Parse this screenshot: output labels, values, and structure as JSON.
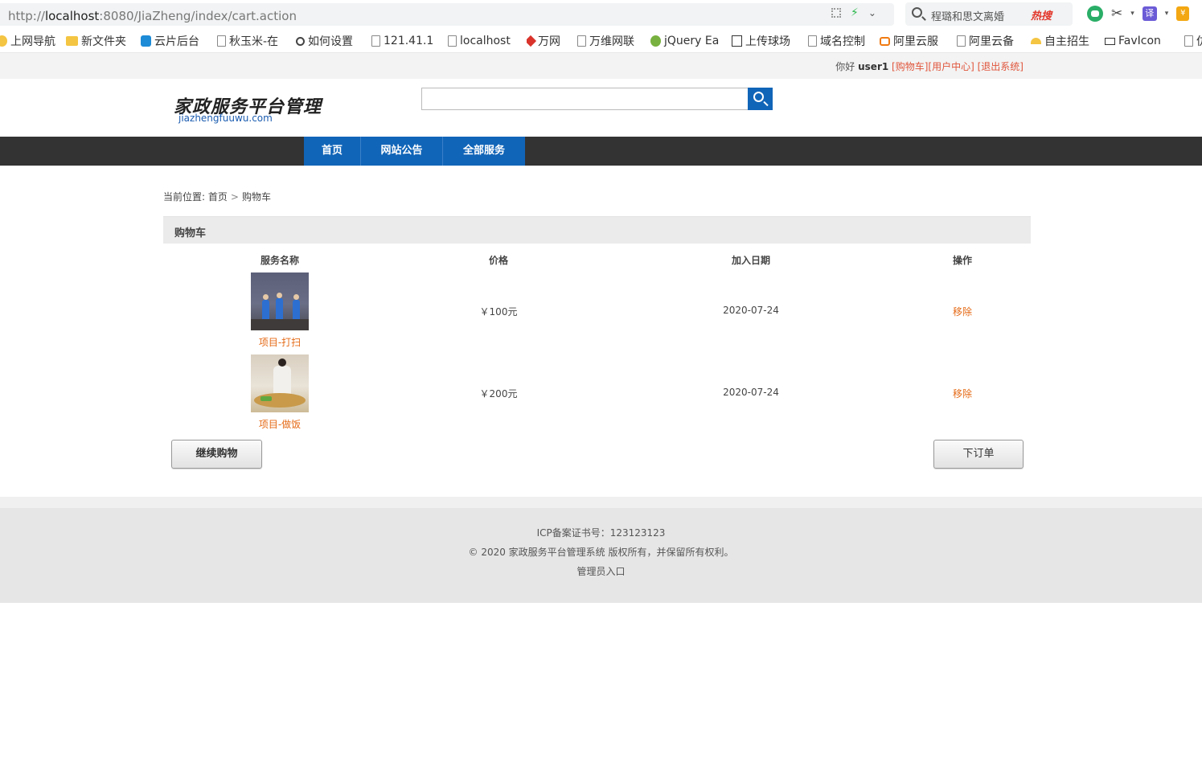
{
  "browser": {
    "url_prefix": "http://",
    "url_host": "localhost",
    "url_rest": ":8080/JiaZheng/index/cart.action",
    "search_text": "程璐和思文离婚",
    "hot_label": "热搜",
    "translate_label": "译",
    "yen_label": "¥",
    "bookmarks": [
      {
        "label": "上网导航",
        "icon": "smile-icon"
      },
      {
        "label": "新文件夹",
        "icon": "folder-icon"
      },
      {
        "label": "云片后台",
        "icon": "cloud-icon"
      },
      {
        "label": "秋玉米-在",
        "icon": "page-icon"
      },
      {
        "label": "如何设置",
        "icon": "swirl-icon"
      },
      {
        "label": "121.41.1",
        "icon": "page-icon"
      },
      {
        "label": "localhost",
        "icon": "page-icon"
      },
      {
        "label": "万网",
        "icon": "wanwang-icon"
      },
      {
        "label": "万维网联",
        "icon": "page-icon"
      },
      {
        "label": "jQuery Ea",
        "icon": "jquery-icon"
      },
      {
        "label": "上传球场",
        "icon": "image-icon"
      },
      {
        "label": "域名控制",
        "icon": "page-icon"
      },
      {
        "label": "阿里云服",
        "icon": "aliyun-icon"
      },
      {
        "label": "阿里云备",
        "icon": "page-icon"
      },
      {
        "label": "自主招生",
        "icon": "sun-icon"
      },
      {
        "label": "FavIcon",
        "icon": "favicon-icon"
      },
      {
        "label": "仿",
        "icon": "page-icon"
      }
    ]
  },
  "topbar": {
    "greeting": "你好",
    "username": "user1",
    "cart_link": "[购物车]",
    "user_center_link": "[用户中心]",
    "logout_link": "[退出系统]"
  },
  "header": {
    "logo_cn": "家政服务平台管理",
    "logo_en": "jiazhengfuuwu.com",
    "search_placeholder": ""
  },
  "nav": {
    "items": [
      "首页",
      "网站公告",
      "全部服务"
    ]
  },
  "breadcrumb": {
    "prefix": "当前位置:",
    "home": "首页",
    "separator": ">",
    "current": "购物车"
  },
  "cart": {
    "title": "购物车",
    "columns": [
      "服务名称",
      "价格",
      "加入日期",
      "操作"
    ],
    "rows": [
      {
        "name": "项目-打扫",
        "price": "￥100元",
        "date": "2020-07-24",
        "action": "移除"
      },
      {
        "name": "项目-做饭",
        "price": "￥200元",
        "date": "2020-07-24",
        "action": "移除"
      }
    ],
    "continue_label": "继续购物",
    "order_label": "下订单"
  },
  "footer": {
    "icp": "ICP备案证书号：123123123",
    "copyright": "© 2020 家政服务平台管理系统 版权所有，并保留所有权利。",
    "admin_link": "管理员入口"
  },
  "colors": {
    "nav_bg": "#333333",
    "nav_active": "#1165b8",
    "link_orange": "#e56a16",
    "topbar_link": "#e0563c"
  }
}
